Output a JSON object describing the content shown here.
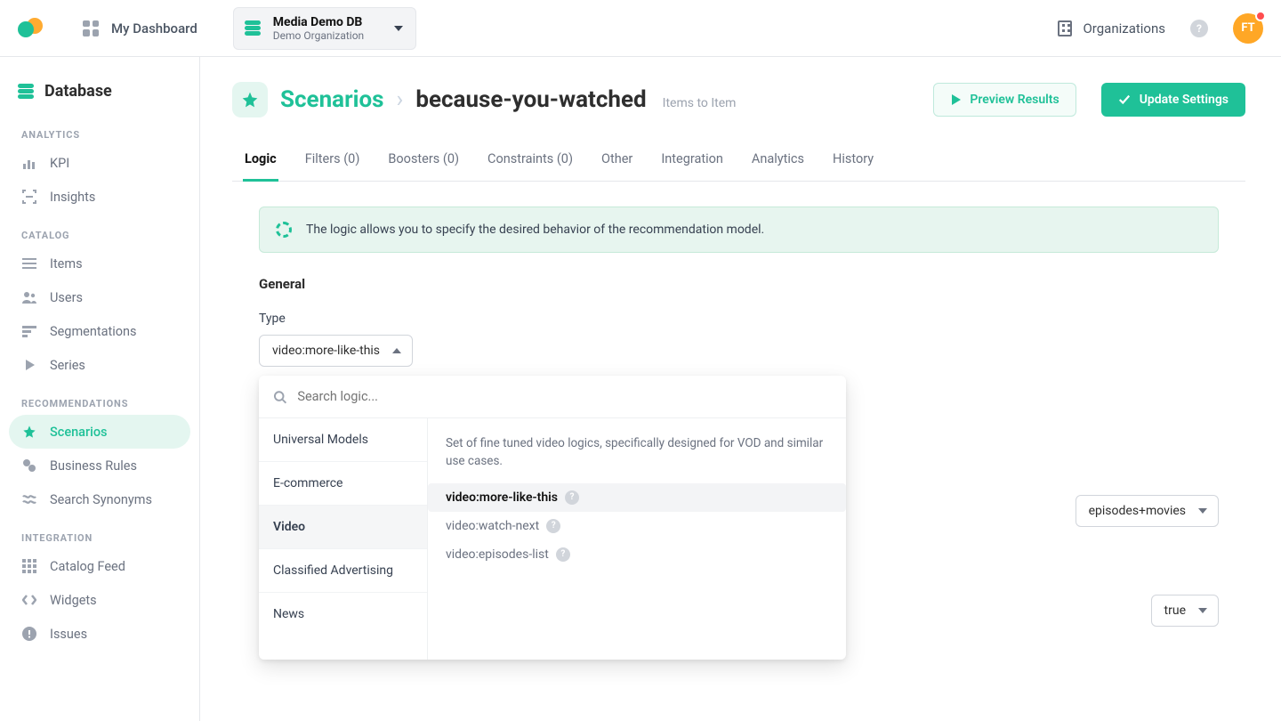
{
  "header": {
    "my_dashboard": "My Dashboard",
    "db_name": "Media Demo DB",
    "db_org": "Demo Organization",
    "organizations": "Organizations",
    "avatar_initials": "FT"
  },
  "sidebar": {
    "title": "Database",
    "sections": {
      "analytics": "ANALYTICS",
      "catalog": "CATALOG",
      "recommendations": "RECOMMENDATIONS",
      "integration": "INTEGRATION"
    },
    "items": {
      "kpi": "KPI",
      "insights": "Insights",
      "items": "Items",
      "users": "Users",
      "segmentations": "Segmentations",
      "series": "Series",
      "scenarios": "Scenarios",
      "business_rules": "Business Rules",
      "search_synonyms": "Search Synonyms",
      "catalog_feed": "Catalog Feed",
      "widgets": "Widgets",
      "issues": "Issues"
    }
  },
  "breadcrumb": {
    "root": "Scenarios",
    "current": "because-you-watched",
    "meta": "Items to Item"
  },
  "actions": {
    "preview": "Preview Results",
    "update": "Update Settings"
  },
  "tabs": {
    "logic": "Logic",
    "filters": "Filters (0)",
    "boosters": "Boosters (0)",
    "constraints": "Constraints (0)",
    "other": "Other",
    "integration": "Integration",
    "analytics": "Analytics",
    "history": "History"
  },
  "info_banner": "The logic allows you to specify the desired behavior of the recommendation model.",
  "general": {
    "title": "General",
    "type_label": "Type",
    "type_value": "video:more-like-this"
  },
  "settings": {
    "row1_value": "episodes+movies",
    "row2_value": "true"
  },
  "dropdown": {
    "search_placeholder": "Search logic...",
    "categories": {
      "universal": "Universal Models",
      "ecommerce": "E-commerce",
      "video": "Video",
      "classified": "Classified Advertising",
      "news": "News"
    },
    "video": {
      "description": "Set of fine tuned video logics, specifically designed for VOD and similar use cases.",
      "options": {
        "more_like_this": "video:more-like-this",
        "watch_next": "video:watch-next",
        "episodes_list": "video:episodes-list"
      }
    }
  }
}
